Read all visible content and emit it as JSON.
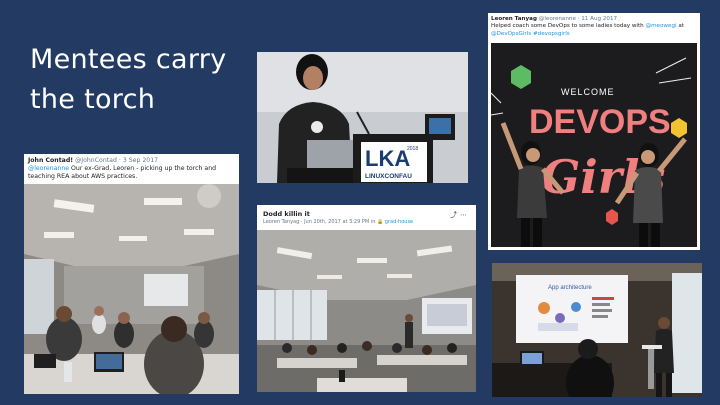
{
  "slide": {
    "title_line1": "Mentees carry",
    "title_line2": "the torch"
  },
  "tweet_john": {
    "author": "John Contad!",
    "handle": "@JohnContad",
    "date": "3 Sep 2017",
    "mention": "@leorenanne",
    "text": " Our ex-Grad, Leoren - picking up the torch and teaching REA about AWS practices."
  },
  "post_dodd": {
    "title": "Dodd killin it",
    "author": "Leoren Tanyag",
    "date": "Jun 20th, 2017 at 3:29 PM in",
    "channel": "grad-house"
  },
  "tweet_leoren": {
    "author": "Leoren Tanyag",
    "handle": "@leorenanne",
    "date": "11 Aug 2017",
    "text_prefix": "Helped coach some DevOps to some ladies today with",
    "text_mention": "@meowegi",
    "text_at": "at",
    "text_tags": "@DevOpsGirls #devopsgirls"
  },
  "banner_lca": {
    "brand": "LKA",
    "year": "2018",
    "tagline": "LINUXCONFAU"
  },
  "mural": {
    "welcome": "WELCOME",
    "word1": "DEVOPS",
    "word2": "Girls"
  },
  "screen_app": {
    "heading": "App architecture"
  },
  "colors": {
    "background": "#233a63",
    "link": "#1b95e0",
    "meta": "#657786"
  }
}
